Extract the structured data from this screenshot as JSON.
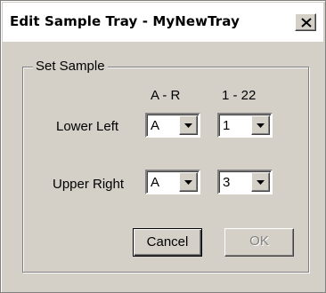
{
  "window": {
    "title": "Edit Sample Tray - MyNewTray",
    "close_symbol": "×"
  },
  "group": {
    "label": "Set Sample",
    "col_letter_header": "A - R",
    "col_number_header": "1 - 22"
  },
  "rows": [
    {
      "label": "Lower Left",
      "letter": "A",
      "number": "1"
    },
    {
      "label": "Upper Right",
      "letter": "A",
      "number": "3"
    }
  ],
  "buttons": {
    "cancel_label": "Cancel",
    "ok_label": "OK",
    "ok_enabled": false
  },
  "icons": {
    "close": "close-icon",
    "dropdown": "chevron-down-icon"
  }
}
